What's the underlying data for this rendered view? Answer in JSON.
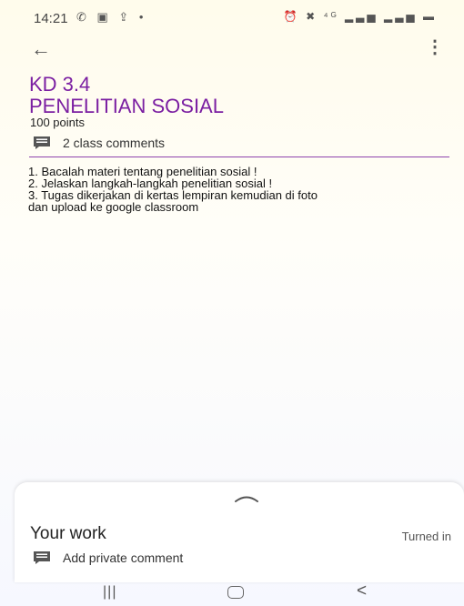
{
  "status_bar": {
    "time": "14:21",
    "left_icons": "✆ ▣ ⇪ •",
    "right_icons": "⏰ ✖ ⁴ᴳ ▂▃▅ ▂▃▅ ▬"
  },
  "header": {
    "title_line1": "KD 3.4",
    "title_line2": "PENELITIAN SOSIAL",
    "points": "100 points",
    "comments": "2 class comments"
  },
  "instructions": [
    "1. Bacalah materi tentang penelitian sosial !",
    "2. Jelaskan langkah-langkah penelitian sosial !",
    "3. Tugas dikerjakan di kertas lempiran kemudian di foto",
    "dan upload ke google classroom"
  ],
  "your_work": {
    "heading": "Your work",
    "status": "Turned in",
    "private_comment": "Add private comment"
  },
  "colors": {
    "accent": "#7b1fa2",
    "divider": "#8e44ad"
  },
  "icons": {
    "back": "back-arrow-icon",
    "more": "more-vert-icon",
    "comment": "comment-icon",
    "sheet_handle": "chevron-up-icon",
    "nav_recents": "recents-icon",
    "nav_home": "home-icon",
    "nav_back": "nav-back-icon"
  }
}
